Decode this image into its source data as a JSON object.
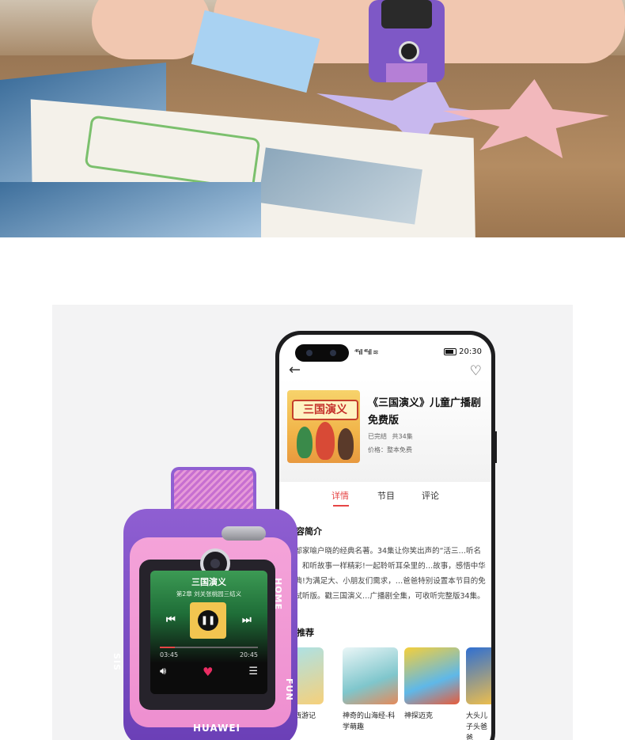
{
  "phone": {
    "status": {
      "signal": "⁴⁶ıll ⁴⁶ıll ≋",
      "time": "20:30"
    },
    "back_icon": "arrow-left-icon",
    "favorite_icon": "heart-outline-icon",
    "cover_title": "三国演义",
    "title": "《三国演义》儿童广播剧 免费版",
    "status_text": "已完结",
    "episodes": "共34集",
    "price": "价格：整本免费",
    "tabs": [
      {
        "label": "详情",
        "active": true
      },
      {
        "label": "节目",
        "active": false
      },
      {
        "label": "评论",
        "active": false
      }
    ],
    "intro_title": "内容简介",
    "intro_text": "一部家喻户晓的经典名著。34集让你笑出声的“活三…听名著，和听故事一样精彩!一起聆听耳朵里的…故事，感悟中华经典!为满足大、小朋友们需求，…爸爸特别设置本节目的免费试听版。戳三国演义…广播剧全集，可收听完整版34集。",
    "recommend_title": "推荐",
    "recommendations": [
      {
        "label": "版西游记"
      },
      {
        "label": "神奇的山海经-科学萌趣"
      },
      {
        "label": "神探迈克"
      },
      {
        "label": "大头儿子头爸爸"
      }
    ]
  },
  "watch": {
    "title": "三国演义",
    "subtitle": "第2章 刘关张桃园三结义",
    "progress": 0.15,
    "time_elapsed": "03:45",
    "time_total": "20:45",
    "home_label": "HOME",
    "fun_label": "FUN",
    "sis_label": "SIS",
    "brand": "HUAWEI"
  },
  "colors": {
    "accent": "#e64545",
    "watch_purple": "#7b4ec4",
    "watch_pink": "#f29ad6"
  }
}
